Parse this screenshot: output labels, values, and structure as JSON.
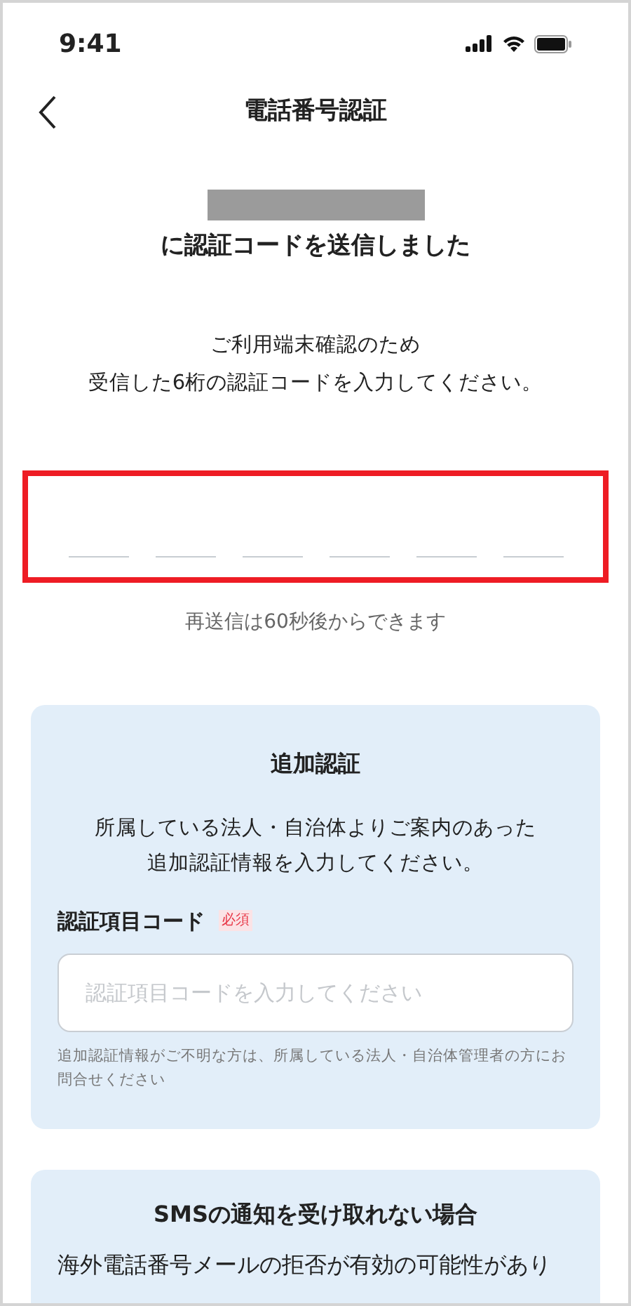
{
  "status_bar": {
    "time": "9:41"
  },
  "nav": {
    "title": "電話番号認証"
  },
  "sent": {
    "redacted": true,
    "message": "に認証コードを送信しました"
  },
  "instructions": [
    "ご利用端末確認のため",
    "受信した6桁の認証コードを入力してください。"
  ],
  "code_input": {
    "highlighted": true,
    "slots": [
      {
        "filled": false
      },
      {
        "filled": false
      },
      {
        "filled": false
      },
      {
        "filled": false
      },
      {
        "filled": false
      },
      {
        "filled": false
      }
    ]
  },
  "resend_note": "再送信は60秒後からできます",
  "additional_auth": {
    "title": "追加認証",
    "description": [
      "所属している法人・自治体よりご案内のあった",
      "追加認証情報を入力してください。"
    ],
    "field_label": "認証項目コード",
    "required_badge": "必須",
    "placeholder": "認証項目コードを入力してください",
    "help": "追加認証情報がご不明な方は、所属している法人・自治体管理者の方にお問合せください"
  },
  "sms_card": {
    "title": "SMSの通知を受け取れない場合",
    "body": "海外電話番号メールの拒否が有効の可能性があり"
  }
}
